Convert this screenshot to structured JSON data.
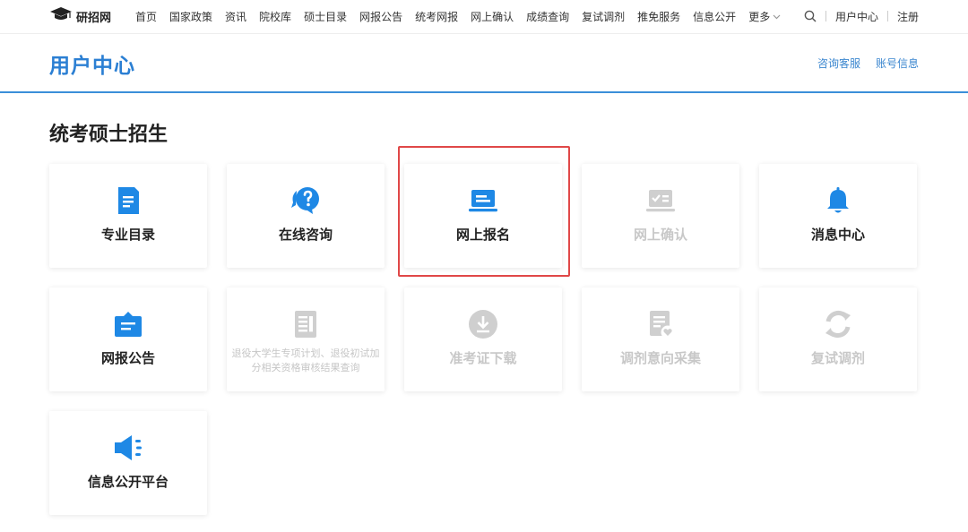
{
  "nav": {
    "logo_text": "研招网",
    "items": [
      "首页",
      "国家政策",
      "资讯",
      "院校库",
      "硕士目录",
      "网报公告",
      "统考网报",
      "网上确认",
      "成绩查询",
      "复试调剂",
      "推免服务",
      "信息公开"
    ],
    "more_label": "更多",
    "user_center": "用户中心",
    "register": "注册"
  },
  "header": {
    "title": "用户中心",
    "links": [
      "咨询客服",
      "账号信息"
    ]
  },
  "section": {
    "title": "统考硕士招生",
    "cards": [
      {
        "label": "专业目录",
        "icon": "document-icon",
        "enabled": true
      },
      {
        "label": "在线咨询",
        "icon": "question-chat-icon",
        "enabled": true
      },
      {
        "label": "网上报名",
        "icon": "laptop-icon",
        "enabled": true,
        "highlighted": true
      },
      {
        "label": "网上确认",
        "icon": "checklist-icon",
        "enabled": false
      },
      {
        "label": "消息中心",
        "icon": "bell-icon",
        "enabled": true
      },
      {
        "label": "网报公告",
        "icon": "briefcase-icon",
        "enabled": true
      },
      {
        "label": "退役大学生专项计划、退役初试加分相关资格审核结果查询",
        "icon": "file-list-icon",
        "enabled": false
      },
      {
        "label": "准考证下载",
        "icon": "download-circle-icon",
        "enabled": false
      },
      {
        "label": "调剂意向采集",
        "icon": "form-heart-icon",
        "enabled": false
      },
      {
        "label": "复试调剂",
        "icon": "refresh-icon",
        "enabled": false
      },
      {
        "label": "信息公开平台",
        "icon": "megaphone-icon",
        "enabled": true
      }
    ]
  },
  "colors": {
    "accent": "#2b7fd3",
    "icon_blue": "#1e88e5",
    "disabled": "#c8c8c8",
    "highlight": "#e04848"
  }
}
